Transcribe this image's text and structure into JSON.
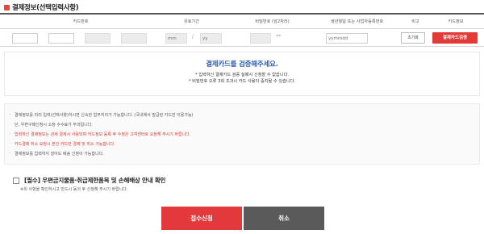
{
  "section": {
    "title": "결제정보(선택입력사항)"
  },
  "table": {
    "headers": [
      "카드번호",
      "유효기간",
      "비밀번호 (앞2자리)",
      "생년월일 또는 사업자등록번호",
      "비고",
      "카드정보"
    ],
    "expiry": {
      "month_placeholder": "mm",
      "separator": "/",
      "year_placeholder": "yy"
    },
    "password": {
      "suffix": "**"
    },
    "birth": {
      "placeholder": "yymmdd"
    },
    "note_button": "초기화",
    "verify_button": "결제카드검증"
  },
  "verify": {
    "title": "결제카드를 검증해주세요.",
    "line1": "* 입력하신 결제카드 검증 실패시 신청할 수 없습니다.",
    "line2": "* 비밀번호 오류 3회 초과시 카드 사용이 중지될 수 있습니다."
  },
  "notices": [
    {
      "text": "결제정보를 미리 입력(선택사항)하시면 신속한 업무처리가 가능합니다. (국내에서 발급된 카드만 이용가능)",
      "color": "normal"
    },
    {
      "text": "단, 우편구매신청시 소정 수수료가 부과됩니다.",
      "color": "normal"
    },
    {
      "text": "입력하신 결제정보는 관세 결제시 사용되며 카드정보 등록 후 수정은 고객센터로 요청해 주시기 바랍니다.",
      "color": "red"
    },
    {
      "text": "카드결제 취소 요청시 본인 카드만 결제 및 취소 가능합니다.",
      "color": "red"
    },
    {
      "text": "결제정보를 입력하지 않아도 배송 신청이 가능합니다.",
      "color": "normal"
    }
  ],
  "agree": {
    "label": "[필수] 우편금지물품·취급제한품목 및 손해배상 안내 확인",
    "desc": "※위 사항을 확인하시고 반드시 동의 후 신청해 주시기 바랍니다."
  },
  "buttons": {
    "submit": "접수신청",
    "cancel": "취소"
  },
  "colors": {
    "accent_red": "#e23a36",
    "accent_blue": "#2b5fb3",
    "cancel_gray": "#5a5a5a"
  }
}
